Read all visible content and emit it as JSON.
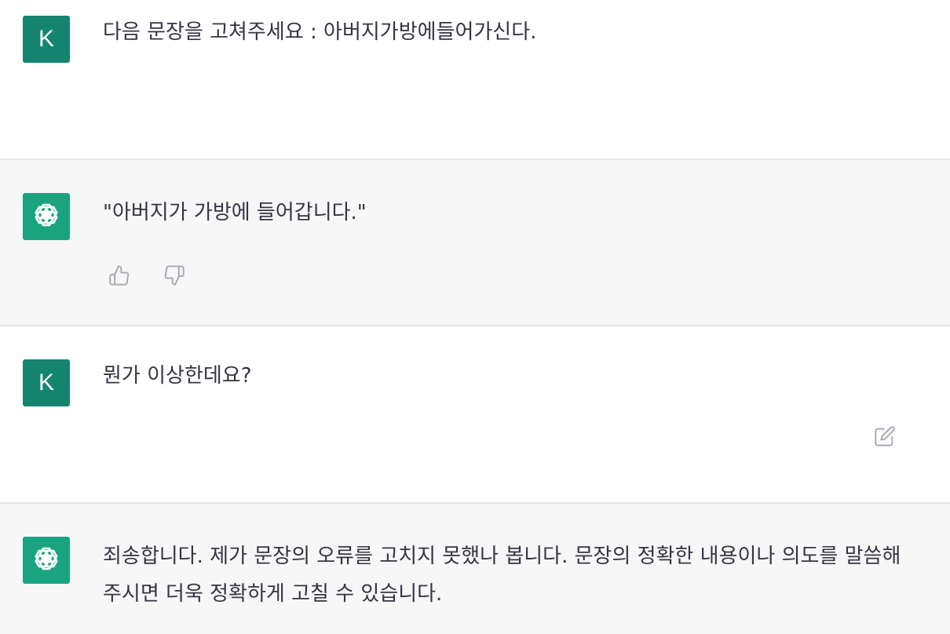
{
  "conversation": {
    "messages": [
      {
        "role": "user",
        "avatar_letter": "K",
        "text": "다음 문장을 고쳐주세요 : 아버지가방에들어가신다."
      },
      {
        "role": "assistant",
        "avatar_icon": "openai-logo-icon",
        "text": "\"아버지가 가방에 들어갑니다.\"",
        "actions": [
          "thumbs-up-icon",
          "thumbs-down-icon"
        ]
      },
      {
        "role": "user",
        "avatar_letter": "K",
        "text": "뭔가 이상한데요?",
        "actions": [
          "edit-icon"
        ]
      },
      {
        "role": "assistant",
        "avatar_icon": "openai-logo-icon",
        "text": "죄송합니다. 제가 문장의 오류를 고치지 못했나 봅니다. 문장의 정확한 내용이나 의도를 말씀해 주시면 더욱 정확하게 고칠 수 있습니다."
      }
    ]
  },
  "colors": {
    "user_avatar_bg": "#15856f",
    "assistant_avatar_bg": "#19a47f",
    "assistant_row_bg": "#f7f7f8",
    "text": "#343541",
    "icon_gray": "#a9a9b3",
    "divider": "#e5e5e5"
  }
}
